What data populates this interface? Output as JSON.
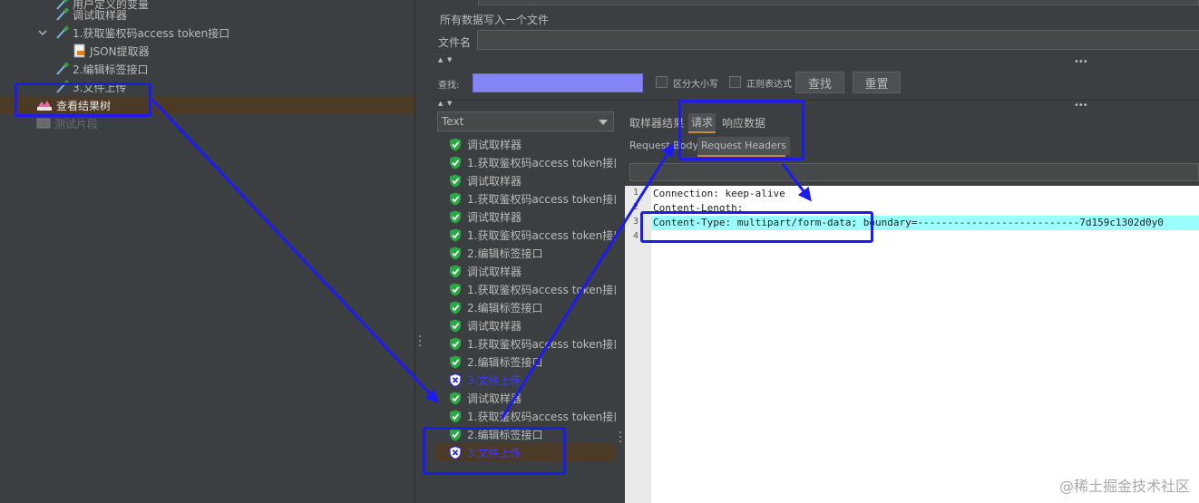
{
  "tree": {
    "items": [
      {
        "label": "用户定义的变量",
        "icon": "dropper-icon"
      },
      {
        "label": "调试取样器",
        "icon": "dropper-icon"
      },
      {
        "label": "1.获取鉴权码access token接口",
        "icon": "dropper-icon"
      },
      {
        "label": "JSON提取器",
        "icon": "json-extractor-icon"
      },
      {
        "label": "2.编辑标签接口",
        "icon": "dropper-icon"
      },
      {
        "label": "3.文件上传",
        "icon": "dropper-icon"
      },
      {
        "label": "查看结果树",
        "icon": "result-tree-icon",
        "selected": true
      },
      {
        "label": "测试片段",
        "icon": "fragment-icon",
        "disabled": true
      }
    ]
  },
  "listener": {
    "write_all_label": "所有数据写入一个文件",
    "filename_label": "文件名",
    "filename_value": ""
  },
  "search": {
    "label": "查找:",
    "value": "",
    "case_sensitive_label": "区分大小写",
    "regex_label": "正则表达式",
    "find_button": "查找",
    "reset_button": "重置"
  },
  "renderer": {
    "selected": "Text"
  },
  "results": [
    {
      "label": "调试取样器",
      "status": "success"
    },
    {
      "label": "1.获取鉴权码access token接口",
      "status": "success"
    },
    {
      "label": "调试取样器",
      "status": "success"
    },
    {
      "label": "1.获取鉴权码access token接口",
      "status": "success"
    },
    {
      "label": "调试取样器",
      "status": "success"
    },
    {
      "label": "1.获取鉴权码access token接口",
      "status": "success"
    },
    {
      "label": "2.编辑标签接口",
      "status": "success"
    },
    {
      "label": "调试取样器",
      "status": "success"
    },
    {
      "label": "1.获取鉴权码access token接口",
      "status": "success"
    },
    {
      "label": "2.编辑标签接口",
      "status": "success"
    },
    {
      "label": "调试取样器",
      "status": "success"
    },
    {
      "label": "1.获取鉴权码access token接口",
      "status": "success"
    },
    {
      "label": "2.编辑标签接口",
      "status": "success"
    },
    {
      "label": "3.文件上传",
      "status": "fail"
    },
    {
      "label": "调试取样器",
      "status": "success"
    },
    {
      "label": "1.获取鉴权码access token接口",
      "status": "success"
    },
    {
      "label": "2.编辑标签接口",
      "status": "success"
    },
    {
      "label": "3.文件上传",
      "status": "fail",
      "selected": true
    }
  ],
  "tabs": {
    "sampler_result": "取样器结果",
    "request": "请求",
    "response_data": "响应数据"
  },
  "subtabs": {
    "request_body": "Request Body",
    "request_headers": "Request Headers"
  },
  "headers": {
    "line_numbers": [
      "1",
      "2",
      "3",
      "4"
    ],
    "lines": [
      "Connection: keep-alive",
      "Content-Length: ",
      "Content-Type: multipart/form-data; boundary=---------------------------7d159c1302d0y0",
      ""
    ]
  },
  "colors": {
    "annotation": "#1c1cf0",
    "highlight_line": "#99ffff",
    "search_field": "#8585f8",
    "selection": "#4b3a25"
  },
  "watermark": "@稀土掘金技术社区"
}
